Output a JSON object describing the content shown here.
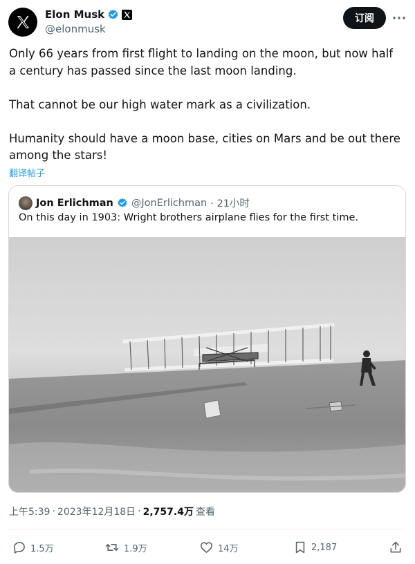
{
  "author": {
    "name": "Elon Musk",
    "handle": "@elonmusk",
    "verified": true,
    "affiliate_badge": "X"
  },
  "subscribe_label": "订阅",
  "post": {
    "paragraphs": [
      "Only 66 years from first flight to landing on the moon, but now half a century has passed since the last moon landing.",
      "That cannot be our high water mark as a civilization.",
      "Humanity should have a moon base, cities on Mars and be out there among the stars!"
    ],
    "translate_label": "翻译帖子"
  },
  "quoted": {
    "name": "Jon Erlichman",
    "handle": "@JonErlichman",
    "time": "· 21小时",
    "text": "On this day in 1903: Wright brothers airplane flies for the first time."
  },
  "meta": {
    "time": "上午5:39",
    "sep1": "·",
    "date": "2023年12月18日",
    "sep2": "·",
    "views": "2,757.4万",
    "views_label": "查看"
  },
  "actions": {
    "replies": "1.5万",
    "reposts": "1.9万",
    "likes": "14万",
    "bookmarks": "2,187"
  },
  "colors": {
    "accent": "#1d9bf0",
    "text": "#0f1419",
    "muted": "#536471",
    "border": "#cfd9de"
  },
  "icons": [
    "x-logo-icon",
    "verified-badge-icon",
    "x-affiliate-icon",
    "more-icon",
    "reply-icon",
    "repost-icon",
    "like-icon",
    "bookmark-icon",
    "share-icon"
  ]
}
